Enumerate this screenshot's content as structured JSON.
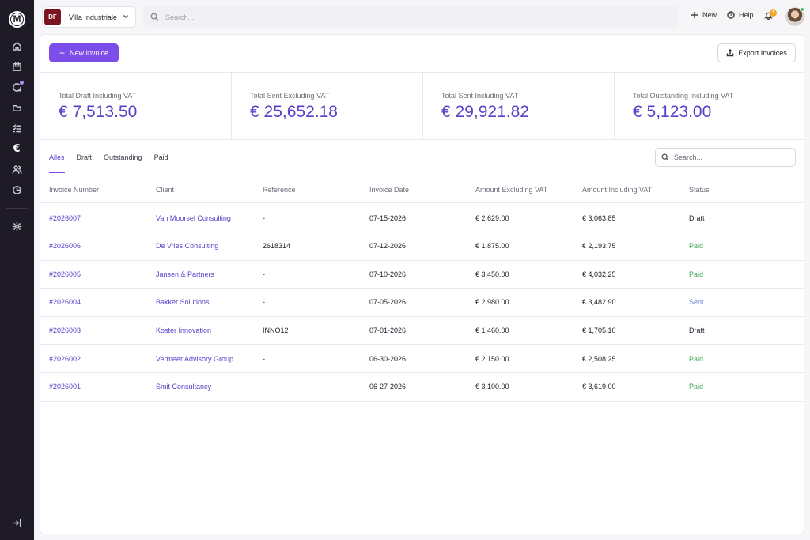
{
  "sidebar": {
    "logo": "M",
    "euro_symbol": "€"
  },
  "company": {
    "initials": "DF",
    "name": "Villa Industriale"
  },
  "top_search": {
    "placeholder": "Search..."
  },
  "top_actions": {
    "new_label": "New",
    "help_label": "Help",
    "notification_count": "1"
  },
  "toolbar": {
    "new_invoice_label": "New Invoice",
    "export_label": "Export Invoices"
  },
  "stats": [
    {
      "label": "Total Draft Including VAT",
      "value": "€ 7,513.50"
    },
    {
      "label": "Total Sent Excluding VAT",
      "value": "€ 25,652.18"
    },
    {
      "label": "Total Sent Including VAT",
      "value": "€ 29,921.82"
    },
    {
      "label": "Total Outstanding Including VAT",
      "value": "€ 5,123.00"
    }
  ],
  "tabs": [
    "Alles",
    "Draft",
    "Outstanding",
    "Paid"
  ],
  "table_search": {
    "placeholder": "Search..."
  },
  "table": {
    "columns": [
      "Invoice Number",
      "Client",
      "Reference",
      "Invoice Date",
      "Amount Excluding VAT",
      "Amount Including VAT",
      "Status"
    ],
    "rows": [
      {
        "number": "#2026007",
        "client": "Van Moorsel Consulting",
        "reference": "-",
        "date": "07-15-2026",
        "excl": "€ 2,629.00",
        "incl": "€ 3,063.85",
        "status": "Draft"
      },
      {
        "number": "#2026006",
        "client": "De Vries Consulting",
        "reference": "2618314",
        "date": "07-12-2026",
        "excl": "€ 1,875.00",
        "incl": "€ 2,193.75",
        "status": "Paid"
      },
      {
        "number": "#2026005",
        "client": "Jansen & Partners",
        "reference": "-",
        "date": "07-10-2026",
        "excl": "€ 3,450.00",
        "incl": "€ 4,032.25",
        "status": "Paid"
      },
      {
        "number": "#2026004",
        "client": "Bakker Solutions",
        "reference": "-",
        "date": "07-05-2026",
        "excl": "€ 2,980.00",
        "incl": "€ 3,482.90",
        "status": "Sent"
      },
      {
        "number": "#2026003",
        "client": "Koster Innovation",
        "reference": "INNO12",
        "date": "07-01-2026",
        "excl": "€ 1,460.00",
        "incl": "€ 1,705.10",
        "status": "Draft"
      },
      {
        "number": "#2026002",
        "client": "Vermeer Advisory Group",
        "reference": "-",
        "date": "06-30-2026",
        "excl": "€ 2,150.00",
        "incl": "€ 2,508.25",
        "status": "Paid"
      },
      {
        "number": "#2026001",
        "client": "Smit Consultancy",
        "reference": "-",
        "date": "06-27-2026",
        "excl": "€ 3,100.00",
        "incl": "€ 3,619.00",
        "status": "Paid"
      }
    ]
  },
  "colors": {
    "accent": "#7c4de8",
    "accent_text": "#5b3ec8",
    "sidebar_bg": "#1e1b26",
    "paid": "#3ea856",
    "sent": "#5d7fd6",
    "company_badge": "#7b1323"
  }
}
